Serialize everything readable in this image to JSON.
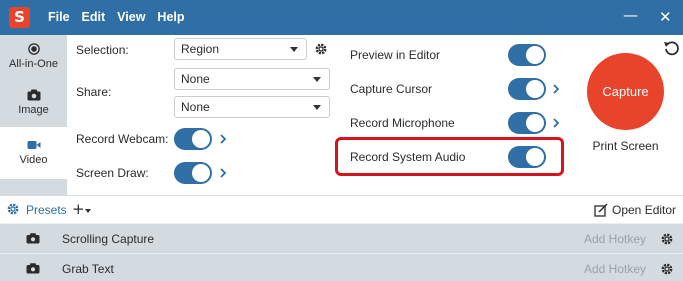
{
  "colors": {
    "titlebar": "#2f6fa6",
    "accent": "#2f6fa6",
    "capture": "#e8432b",
    "highlight": "#d6141c"
  },
  "app": {
    "logo_letter": "S"
  },
  "menu": [
    "File",
    "Edit",
    "View",
    "Help"
  ],
  "window_controls": {
    "minimize_icon": "minimize-icon",
    "close_icon": "close-icon",
    "minimize_glyph": "—",
    "close_glyph": "✕"
  },
  "modes": [
    {
      "label": "All-in-One",
      "icon": "all-in-one-icon"
    },
    {
      "label": "Image",
      "icon": "camera-icon"
    },
    {
      "label": "Video",
      "icon": "video-camera-icon",
      "selected": true
    }
  ],
  "settings": {
    "selection": {
      "label": "Selection:",
      "value": "Region"
    },
    "share": {
      "label": "Share:",
      "value1": "None",
      "value2": "None"
    },
    "record_webcam": {
      "label": "Record Webcam:",
      "on": true
    },
    "screen_draw": {
      "label": "Screen Draw:",
      "on": true
    },
    "preview_in_editor": {
      "label": "Preview in Editor",
      "on": true
    },
    "capture_cursor": {
      "label": "Capture Cursor",
      "on": true
    },
    "record_microphone": {
      "label": "Record Microphone",
      "on": true
    },
    "record_system_audio": {
      "label": "Record System Audio",
      "on": true
    }
  },
  "capture": {
    "button_label": "Capture",
    "preset_label": "Print Screen"
  },
  "presets": {
    "label": "Presets",
    "add_glyph": "+",
    "open_editor": "Open Editor",
    "items": [
      {
        "name": "Scrolling Capture",
        "hotkey": "Add Hotkey"
      },
      {
        "name": "Grab Text",
        "hotkey": "Add Hotkey"
      }
    ]
  }
}
